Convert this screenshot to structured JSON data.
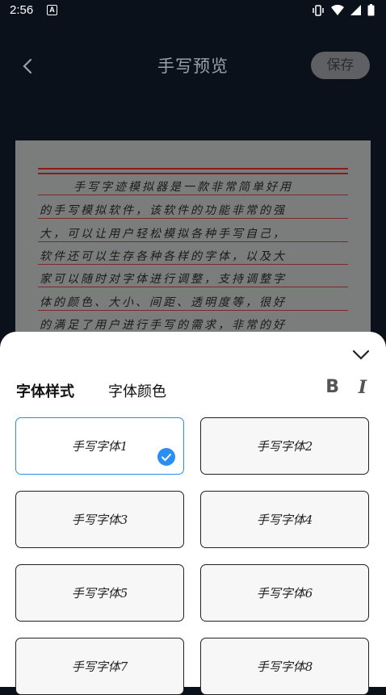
{
  "status": {
    "time": "2:56",
    "a_badge": "A"
  },
  "header": {
    "title": "手写预览",
    "save_label": "保存"
  },
  "preview": {
    "lines": [
      "手写字迹模拟器是一款非常简单好用",
      "的手写模拟软件，该软件的功能非常的强",
      "大，可以让用户轻松模拟各种手写自己，",
      "软件还可以生存各种各样的字体，以及大",
      "家可以随时对字体进行调整，支持调整字",
      "体的颜色、大小、间距、透明度等，很好",
      "的满足了用户进行手写的需求，非常的好"
    ]
  },
  "panel": {
    "tabs": [
      "字体样式",
      "字体颜色"
    ],
    "bold_label": "B",
    "italic_label": "I",
    "fonts": [
      "手写字体1",
      "手写字体2",
      "手写字体3",
      "手写字体4",
      "手写字体5",
      "手写字体6",
      "手写字体7",
      "手写字体8"
    ],
    "selected_index": 0
  },
  "colors": {
    "accent": "#2a8ff0",
    "bg": "#0b111a",
    "save_bg": "#5e6064"
  }
}
